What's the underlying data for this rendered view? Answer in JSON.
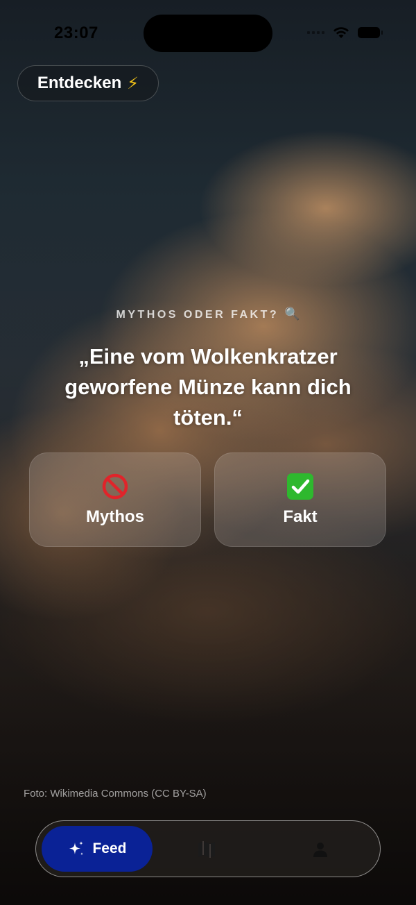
{
  "status_bar": {
    "time": "23:07"
  },
  "header": {
    "discover_label": "Entdecken",
    "discover_emoji": "⚡"
  },
  "quiz": {
    "kicker": "MYTHOS ODER FAKT?",
    "kicker_emoji": "🔍",
    "question": "„Eine vom Wolkenkratzer geworfene Münze kann dich töten.“",
    "answers": [
      {
        "label": "Mythos",
        "icon": "no-entry-icon"
      },
      {
        "label": "Fakt",
        "icon": "check-mark-icon"
      }
    ]
  },
  "photo_credit": "Foto: Wikimedia Commons (CC BY-SA)",
  "tab_bar": {
    "items": [
      {
        "label": "Feed",
        "icon": "sparkles-icon",
        "active": true
      },
      {
        "label": "",
        "icon": "map-icon",
        "active": false
      },
      {
        "label": "",
        "icon": "person-icon",
        "active": false
      }
    ]
  },
  "colors": {
    "accent": "#0a2296",
    "fact_green": "#2eb82e",
    "myth_red": "#e0242a"
  }
}
